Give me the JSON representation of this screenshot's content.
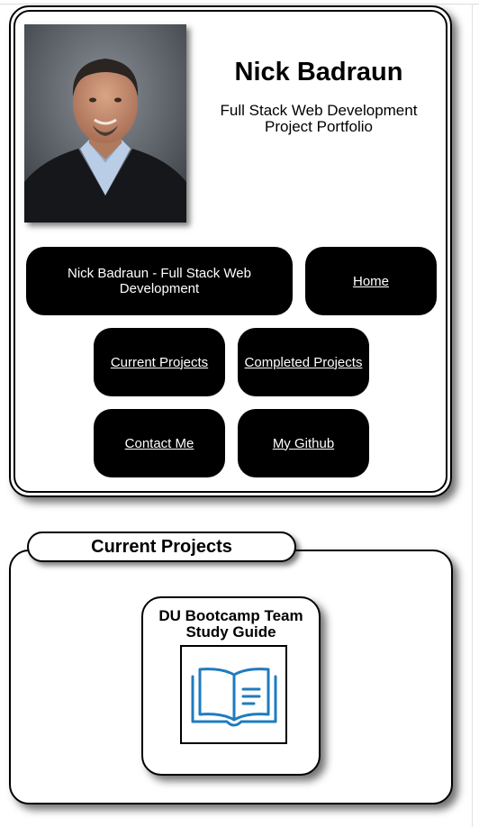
{
  "header": {
    "name": "Nick Badraun",
    "subtitle_line1": "Full Stack Web Development",
    "subtitle_line2": "Project Portfolio",
    "portrait_alt": "Nick Badraun headshot"
  },
  "nav": {
    "brand_label": "Nick Badraun - Full Stack Web Development",
    "home_label": "Home",
    "current_projects_label": "Current Projects",
    "completed_projects_label": "Completed Projects",
    "contact_label": "Contact Me",
    "github_label": "My Github"
  },
  "current_projects": {
    "heading": "Current Projects",
    "cards": [
      {
        "title": "DU Bootcamp Team Study Guide",
        "icon": "open-book-icon"
      }
    ]
  },
  "colors": {
    "button_bg": "#000000",
    "button_text": "#ffffff",
    "icon_stroke": "#1f7bbf"
  }
}
